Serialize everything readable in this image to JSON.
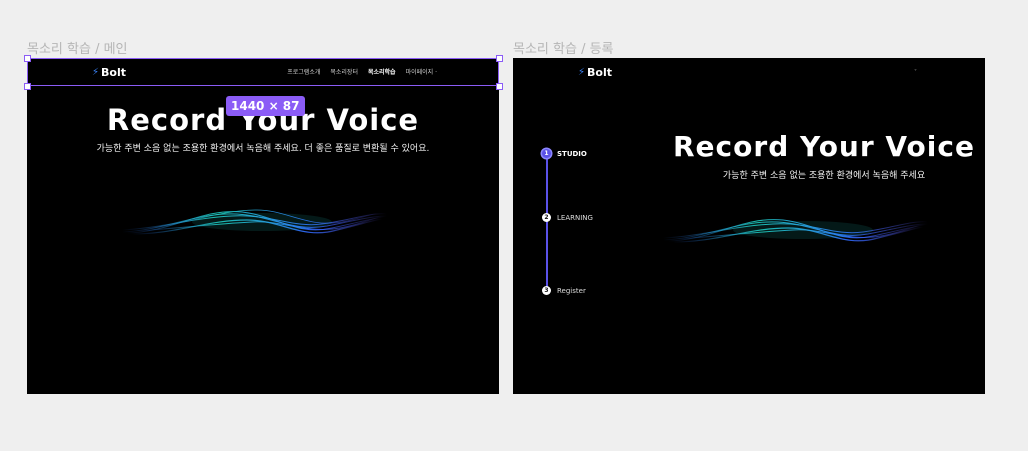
{
  "frames": {
    "main": {
      "label": "목소리 학습 / 메인",
      "logo": {
        "bolt": "⚡",
        "text": "Bolt"
      },
      "nav": [
        "프로그램소개",
        "목소리장터",
        "목소리학습",
        "마이페이지 ·"
      ],
      "hero": {
        "title": "Record Your Voice",
        "subtitle": "가능한 주변 소음 없는 조용한 환경에서 녹음해 주세요. 더 좋은 품질로 변환될 수 있어요."
      }
    },
    "register": {
      "label": "목소리 학습 / 등록",
      "logo": {
        "bolt": "⚡",
        "text": "Bolt"
      },
      "chevron": "˅",
      "hero": {
        "title": "Record Your Voice",
        "subtitle": "가능한 주변 소음 없는 조용한 환경에서 녹음해 주세요"
      },
      "steps": [
        {
          "num": "1",
          "label": "STUDIO",
          "active": true
        },
        {
          "num": "2",
          "label": "LEARNING",
          "active": false
        },
        {
          "num": "3",
          "label": "Register",
          "active": false
        }
      ]
    }
  },
  "selection": {
    "dimensions": "1440 × 87",
    "color": "#8b5cf6"
  },
  "colors": {
    "accent": "#3b82f6",
    "step_accent": "#5b52e8",
    "wave_teal": "#1fd1c3",
    "wave_blue": "#2f6bff"
  }
}
